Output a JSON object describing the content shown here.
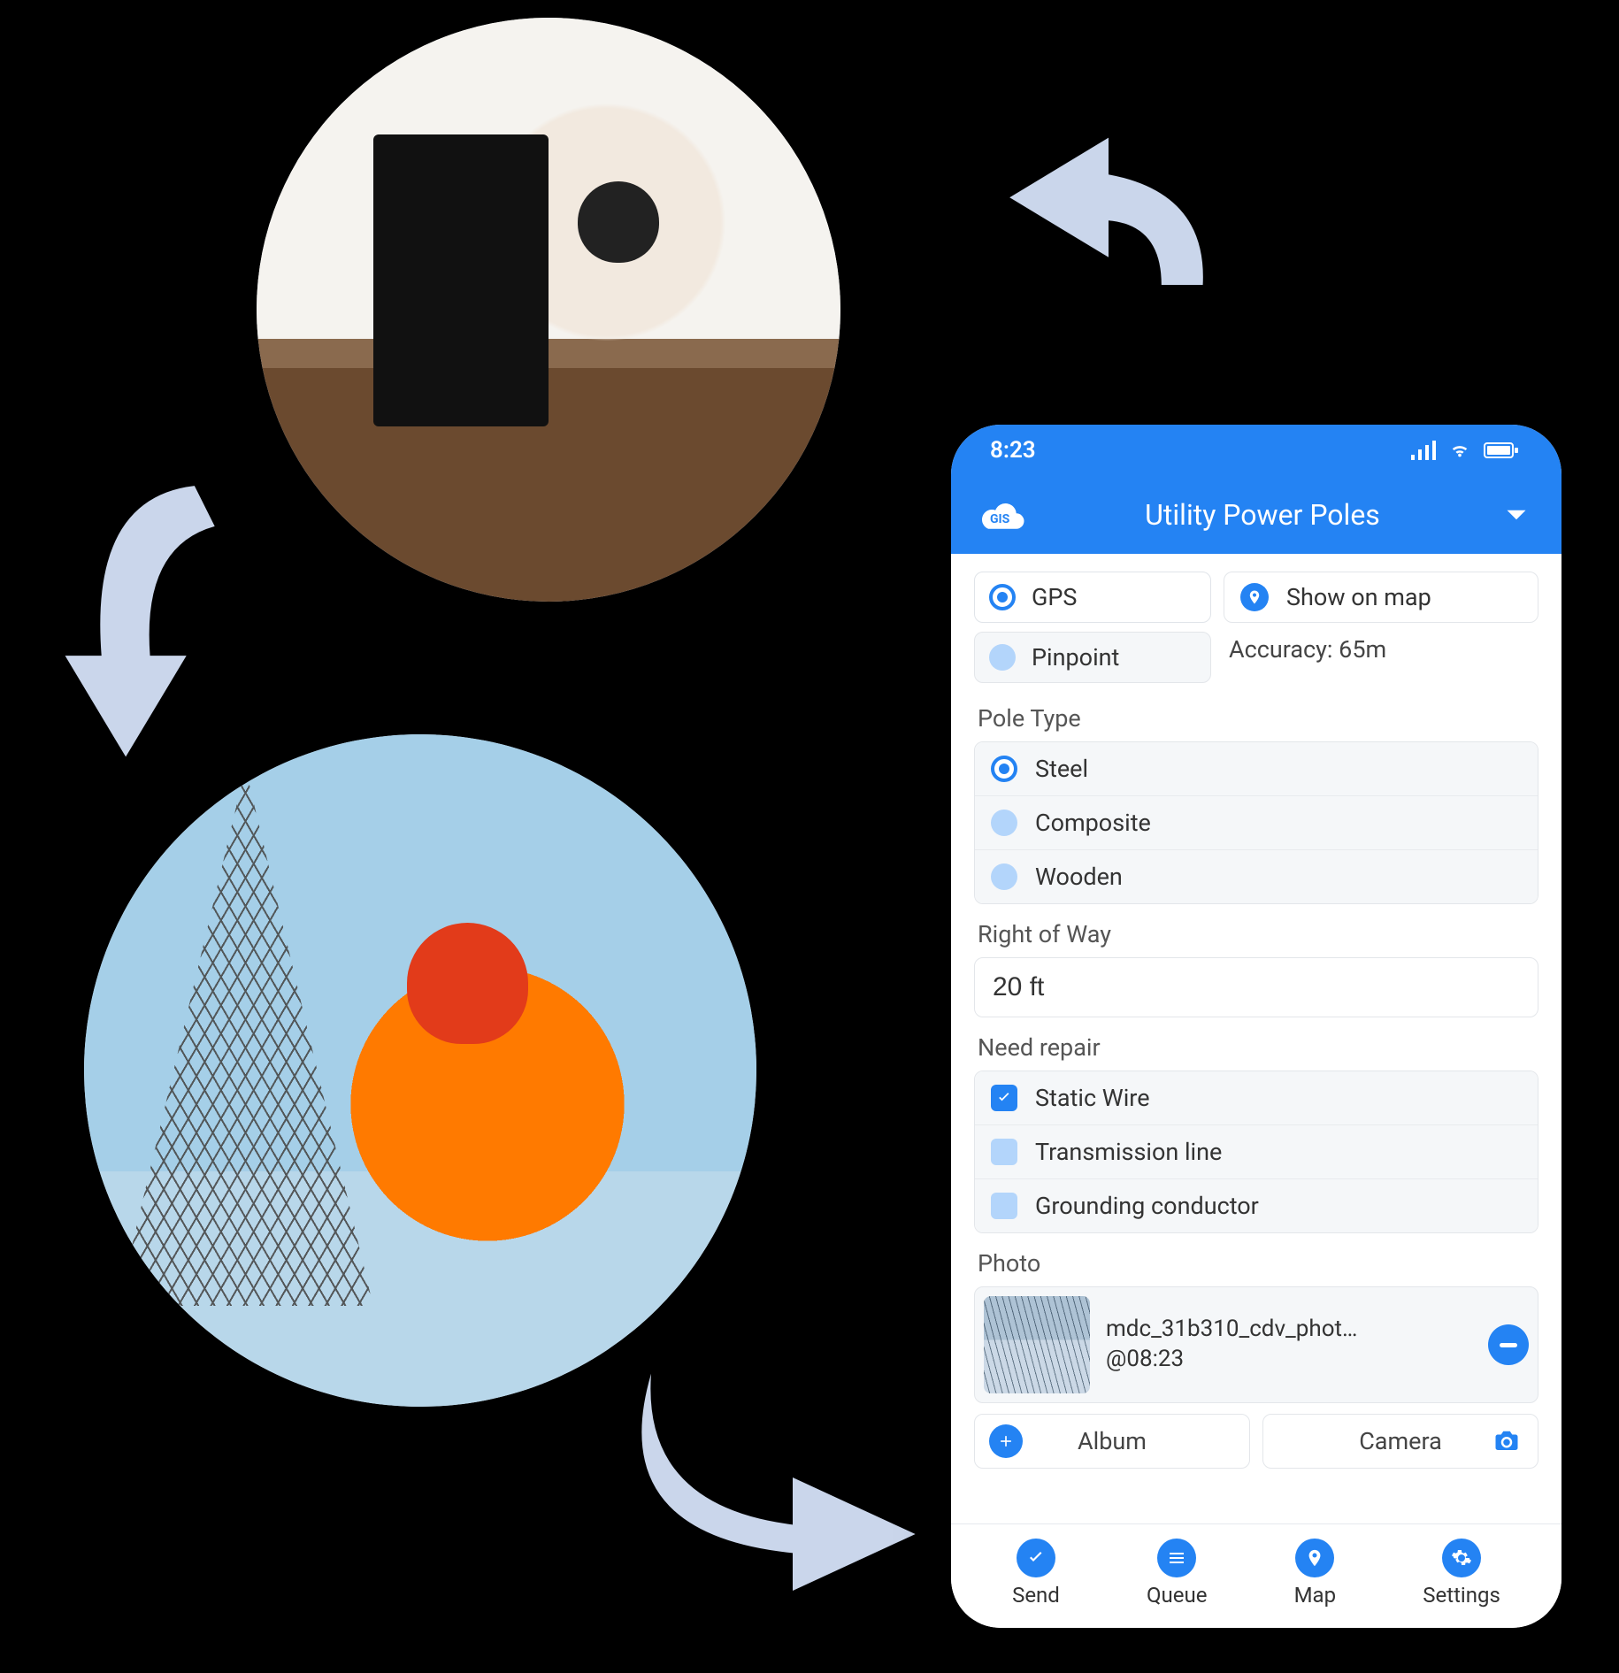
{
  "statusbar": {
    "time": "8:23"
  },
  "header": {
    "app_logo": "GIS",
    "title": "Utility Power Poles"
  },
  "location": {
    "options": [
      {
        "label": "GPS",
        "selected": true
      },
      {
        "label": "Pinpoint",
        "selected": false
      }
    ],
    "show_on_map": "Show on map",
    "accuracy": "Accuracy: 65m"
  },
  "pole_type": {
    "label": "Pole Type",
    "options": [
      {
        "label": "Steel",
        "selected": true
      },
      {
        "label": "Composite",
        "selected": false
      },
      {
        "label": "Wooden",
        "selected": false
      }
    ]
  },
  "right_of_way": {
    "label": "Right of Way",
    "value": "20 ft"
  },
  "need_repair": {
    "label": "Need repair",
    "options": [
      {
        "label": "Static Wire",
        "checked": true
      },
      {
        "label": "Transmission line",
        "checked": false
      },
      {
        "label": "Grounding conductor",
        "checked": false
      }
    ]
  },
  "photo": {
    "label": "Photo",
    "filename": "mdc_31b310_cdv_phot…",
    "timestamp": "@08:23",
    "album_label": "Album",
    "camera_label": "Camera"
  },
  "tabs": {
    "send": "Send",
    "queue": "Queue",
    "map": "Map",
    "settings": "Settings"
  }
}
